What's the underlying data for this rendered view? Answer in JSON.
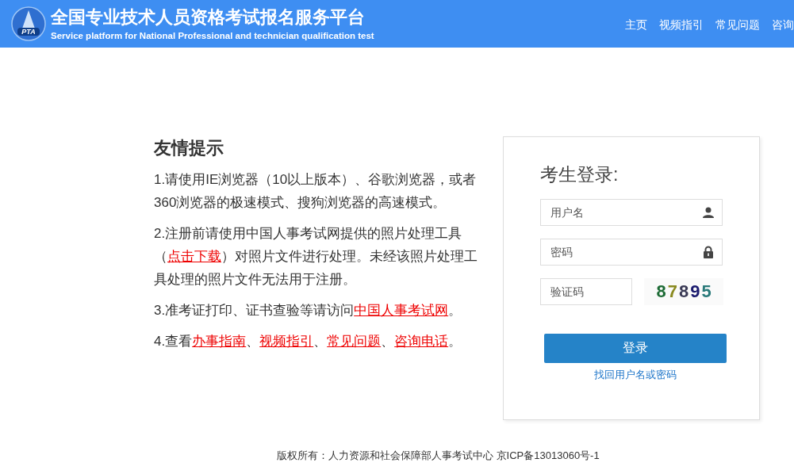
{
  "header": {
    "title": "全国专业技术人员资格考试报名服务平台",
    "subtitle": "Service platform for National Professional and technician qualification test",
    "logo_text": "PTA",
    "nav": [
      "主页",
      "视频指引",
      "常见问题",
      "咨询"
    ]
  },
  "tips": {
    "heading": "友情提示",
    "items": [
      [
        {
          "kind": "text",
          "text": "1.请使用IE浏览器（10以上版本）、谷歌浏览器，或者360浏览器的极速模式、搜狗浏览器的高速模式。"
        }
      ],
      [
        {
          "kind": "text",
          "text": "2.注册前请使用中国人事考试网提供的照片处理工具（"
        },
        {
          "kind": "link",
          "text": "点击下载"
        },
        {
          "kind": "text",
          "text": "）对照片文件进行处理。未经该照片处理工具处理的照片文件无法用于注册。"
        }
      ],
      [
        {
          "kind": "text",
          "text": "3.准考证打印、证书查验等请访问"
        },
        {
          "kind": "link",
          "text": "中国人事考试网"
        },
        {
          "kind": "text",
          "text": "。"
        }
      ],
      [
        {
          "kind": "text",
          "text": "4.查看"
        },
        {
          "kind": "link",
          "text": "办事指南"
        },
        {
          "kind": "text",
          "text": "、"
        },
        {
          "kind": "link",
          "text": "视频指引"
        },
        {
          "kind": "text",
          "text": "、"
        },
        {
          "kind": "link",
          "text": "常见问题"
        },
        {
          "kind": "text",
          "text": "、"
        },
        {
          "kind": "link",
          "text": "咨询电话"
        },
        {
          "kind": "text",
          "text": "。"
        }
      ]
    ]
  },
  "login": {
    "title": "考生登录:",
    "username": {
      "placeholder": "用户名"
    },
    "password": {
      "placeholder": "密码"
    },
    "captcha": {
      "placeholder": "验证码",
      "code": "87895"
    },
    "submit": "登录",
    "recover_link": "找回用户名或密码"
  },
  "footer": "版权所有：人力资源和社会保障部人事考试中心 京ICP备13013060号-1"
}
